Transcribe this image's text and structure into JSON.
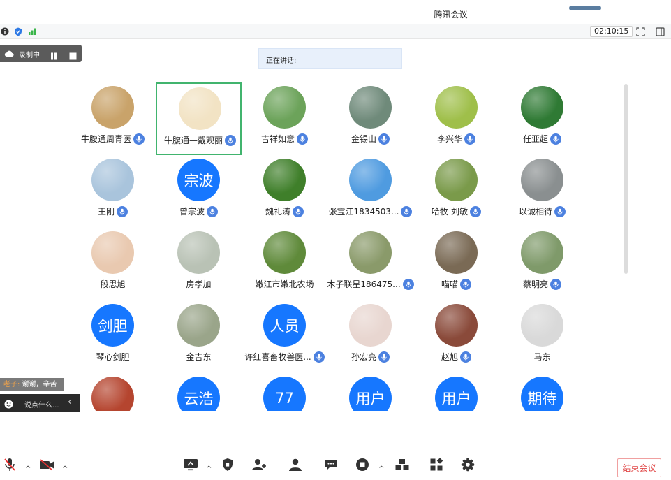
{
  "window": {
    "title": "腾讯会议"
  },
  "toolbar": {
    "timer": "02:10:15"
  },
  "recording": {
    "label": "录制中"
  },
  "speaker": {
    "label": "正在讲话:"
  },
  "participants": [
    {
      "name": "牛腹通周青医",
      "mic": true,
      "avatar": "photo",
      "bg": "#c9a36a"
    },
    {
      "name": "牛腹通—戴观丽",
      "mic": true,
      "avatar": "photo",
      "bg": "#f2e3c4",
      "active": true
    },
    {
      "name": "吉祥如意",
      "mic": true,
      "avatar": "photo",
      "bg": "#6ca35a"
    },
    {
      "name": "金锡山",
      "mic": true,
      "avatar": "photo",
      "bg": "#6f8a7a"
    },
    {
      "name": "李兴华",
      "mic": true,
      "avatar": "photo",
      "bg": "#9fbf4a"
    },
    {
      "name": "任亚超",
      "mic": true,
      "avatar": "photo",
      "bg": "#2f7a34"
    },
    {
      "name": "王刚",
      "mic": true,
      "avatar": "photo",
      "bg": "#a9c4dc"
    },
    {
      "name": "曾宗波",
      "mic": true,
      "avatar": "text",
      "text": "宗波",
      "bg": "#1677ff"
    },
    {
      "name": "魏礼涛",
      "mic": true,
      "avatar": "photo",
      "bg": "#3f7f2a"
    },
    {
      "name": "张宝江1834503...",
      "mic": true,
      "avatar": "photo",
      "bg": "#4f9be0"
    },
    {
      "name": "哈牧-刘敏",
      "mic": true,
      "avatar": "photo",
      "bg": "#7a9a4a"
    },
    {
      "name": "以诚相待",
      "mic": true,
      "avatar": "photo",
      "bg": "#8a8f90"
    },
    {
      "name": "段思旭",
      "mic": false,
      "avatar": "photo",
      "bg": "#e9c9b0"
    },
    {
      "name": "房孝加",
      "mic": false,
      "avatar": "photo",
      "bg": "#b9c2b5"
    },
    {
      "name": "嫩江市嫩北农场",
      "mic": false,
      "avatar": "photo",
      "bg": "#5f8a3a"
    },
    {
      "name": "木子联星186475...",
      "mic": true,
      "avatar": "photo",
      "bg": "#8a9a6a"
    },
    {
      "name": "喵喵",
      "mic": true,
      "avatar": "photo",
      "bg": "#7a6a55"
    },
    {
      "name": "蔡明亮",
      "mic": true,
      "avatar": "photo",
      "bg": "#7f9a6a"
    },
    {
      "name": "琴心剑胆",
      "mic": false,
      "avatar": "text",
      "text": "剑胆",
      "bg": "#1677ff"
    },
    {
      "name": "金吉东",
      "mic": false,
      "avatar": "photo",
      "bg": "#9aa58a"
    },
    {
      "name": "许红喜畜牧兽医...",
      "mic": true,
      "avatar": "text",
      "text": "人员",
      "bg": "#1677ff"
    },
    {
      "name": "孙宏亮",
      "mic": true,
      "avatar": "photo",
      "bg": "#e8d6d0"
    },
    {
      "name": "赵旭",
      "mic": true,
      "avatar": "photo",
      "bg": "#8a4a3a"
    },
    {
      "name": "马东",
      "mic": false,
      "avatar": "photo",
      "bg": "#d9d9d9"
    },
    {
      "name": "",
      "mic": false,
      "avatar": "photo",
      "bg": "#b5452f"
    },
    {
      "name": "",
      "mic": false,
      "avatar": "text",
      "text": "云浩",
      "bg": "#1677ff"
    },
    {
      "name": "",
      "mic": false,
      "avatar": "text",
      "text": "77",
      "bg": "#1677ff"
    },
    {
      "name": "",
      "mic": false,
      "avatar": "text",
      "text": "用户",
      "bg": "#1677ff"
    },
    {
      "name": "",
      "mic": false,
      "avatar": "text",
      "text": "用户",
      "bg": "#1677ff"
    },
    {
      "name": "",
      "mic": false,
      "avatar": "text",
      "text": "期待",
      "bg": "#1677ff"
    }
  ],
  "chat": {
    "sender": "老子:",
    "message": "谢谢，辛苦",
    "placeholder": "说点什么...",
    "collapse": "‹"
  },
  "footer": {
    "end_label": "结束会议"
  },
  "colors": {
    "accent": "#1677ff",
    "active_border": "#41b46e",
    "end": "#e14b4b"
  }
}
